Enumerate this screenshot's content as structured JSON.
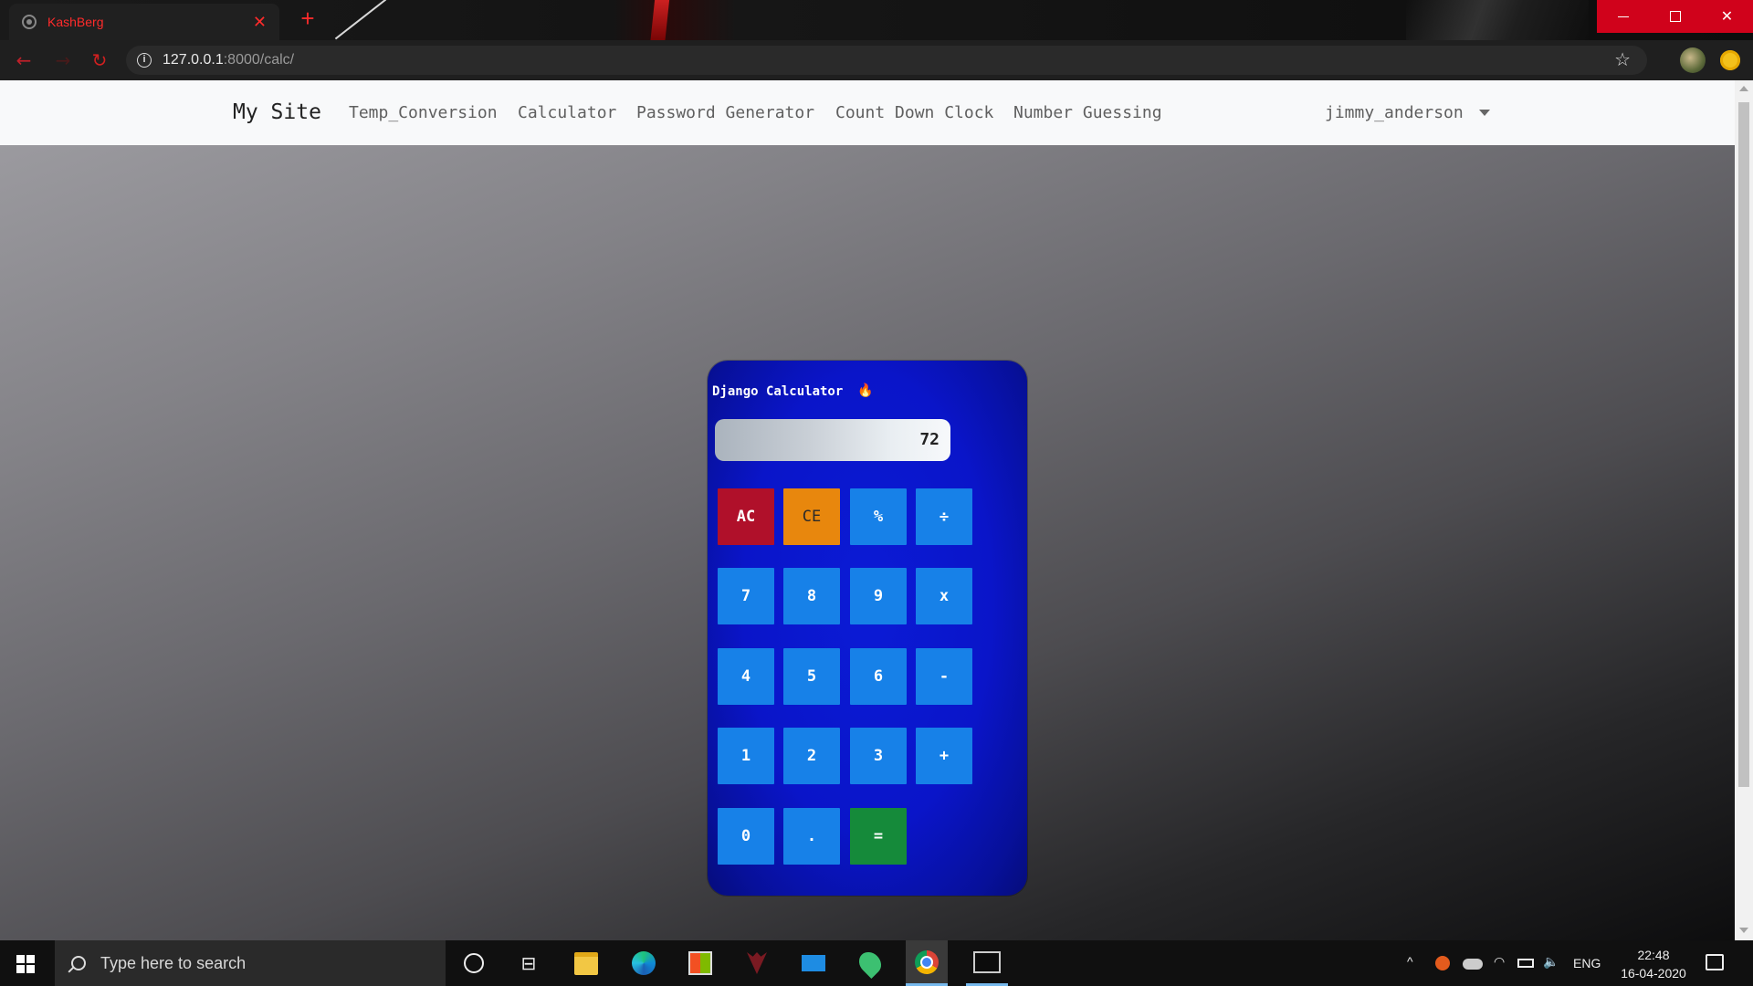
{
  "browser": {
    "tab_title": "KashBerg",
    "tab_close": "✕",
    "new_tab": "+",
    "url_host": "127.0.0.1",
    "url_path": ":8000/calc/",
    "info_icon_glyph": "i",
    "star_glyph": "☆"
  },
  "navbar": {
    "brand": "My Site",
    "links": [
      "Temp_Conversion",
      "Calculator",
      "Password Generator",
      "Count Down Clock",
      "Number Guessing"
    ],
    "user": "jimmy_anderson"
  },
  "calculator": {
    "title": "Django Calculator",
    "title_icon": "🔥",
    "display_value": "72",
    "keys": {
      "ac": "AC",
      "ce": "CE",
      "percent": "%",
      "divide": "÷",
      "seven": "7",
      "eight": "8",
      "nine": "9",
      "multiply": "x",
      "four": "4",
      "five": "5",
      "six": "6",
      "minus": "-",
      "one": "1",
      "two": "2",
      "three": "3",
      "plus": "+",
      "zero": "0",
      "dot": ".",
      "equals": "="
    },
    "colors": {
      "panel": "#0a15c9",
      "key": "#1781e8",
      "ac": "#b0102a",
      "ce": "#e8870d",
      "equals": "#158a3a"
    }
  },
  "taskbar": {
    "search_placeholder": "Type here to search",
    "language": "ENG",
    "time": "22:48",
    "date": "16-04-2020",
    "tray_up_glyph": "^",
    "wifi_glyph": "◠",
    "volume_glyph": "🔈",
    "taskview_glyph": "⊟"
  },
  "colors": {
    "accent_red": "#ff2b2b",
    "navbar_bg": "#f8f9fa",
    "taskbar_bg": "#101010"
  }
}
